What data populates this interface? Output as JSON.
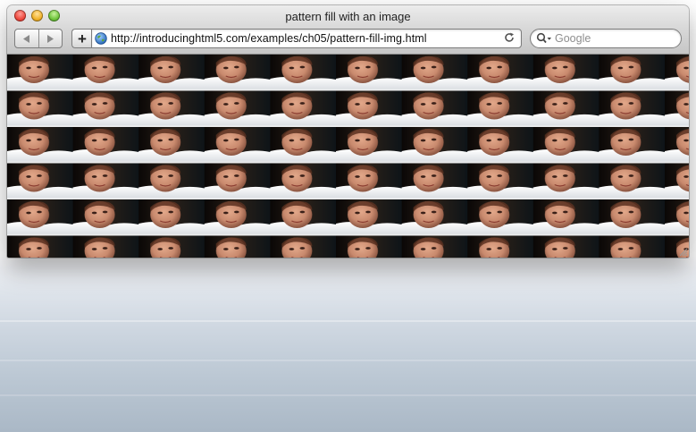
{
  "window": {
    "title": "pattern fill with an image",
    "traffic_lights": [
      {
        "name": "close",
        "color": "#ee4a3f"
      },
      {
        "name": "minimize",
        "color": "#f1b22a"
      },
      {
        "name": "zoom",
        "color": "#6fc43c"
      }
    ]
  },
  "toolbar": {
    "back_icon": "back-arrow-icon",
    "forward_icon": "forward-arrow-icon",
    "add_label": "+",
    "url": "http://introducinghtml5.com/examples/ch05/pattern-fill-img.html",
    "site_icon": "globe-icon",
    "reload_icon": "reload-icon",
    "search_placeholder": "Google",
    "search_icon": "magnifier-dropdown-icon"
  },
  "content": {
    "description_icon": "tiled-photo-pattern",
    "colors": {
      "skin": "#c98a6e",
      "shirt": "#f2f4f6",
      "background": "#120d08"
    }
  }
}
